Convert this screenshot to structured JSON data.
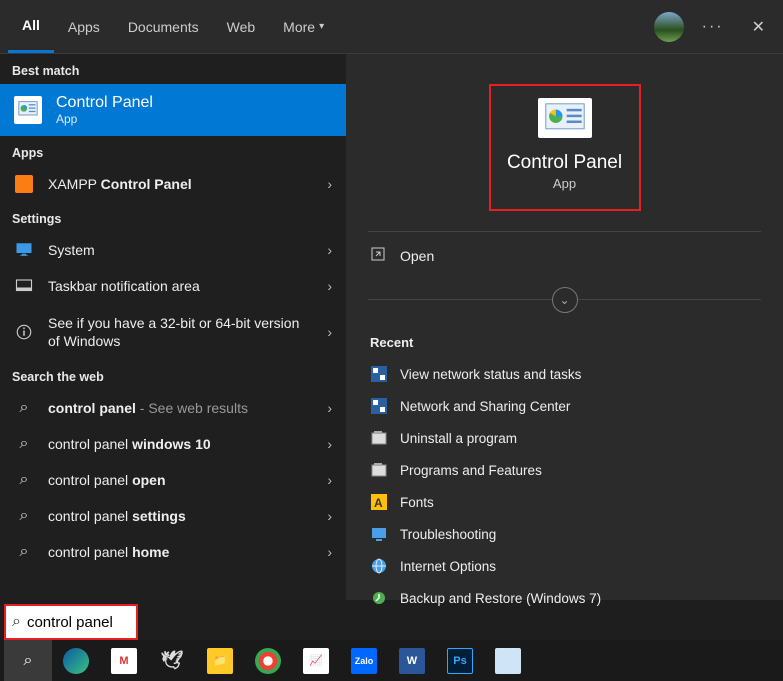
{
  "header": {
    "tabs": [
      "All",
      "Apps",
      "Documents",
      "Web",
      "More"
    ],
    "active_tab": 0
  },
  "left": {
    "best_match_label": "Best match",
    "best_match": {
      "title": "Control Panel",
      "sub": "App"
    },
    "apps_label": "Apps",
    "apps": [
      {
        "prefix": "XAMPP ",
        "bold": "Control Panel"
      }
    ],
    "settings_label": "Settings",
    "settings": [
      {
        "label": "System"
      },
      {
        "label": "Taskbar notification area"
      },
      {
        "label": "See if you have a 32-bit or 64-bit version of Windows"
      }
    ],
    "web_label": "Search the web",
    "web": [
      {
        "bold": "control panel",
        "dim": " - See web results"
      },
      {
        "prefix": "control panel ",
        "bold": "windows 10"
      },
      {
        "prefix": "control panel ",
        "bold": "open"
      },
      {
        "prefix": "control panel ",
        "bold": "settings"
      },
      {
        "prefix": "control panel ",
        "bold": "home"
      }
    ]
  },
  "right": {
    "preview": {
      "title": "Control Panel",
      "sub": "App"
    },
    "open_label": "Open",
    "recent_label": "Recent",
    "recent": [
      "View network status and tasks",
      "Network and Sharing Center",
      "Uninstall a program",
      "Programs and Features",
      "Fonts",
      "Troubleshooting",
      "Internet Options",
      "Backup and Restore (Windows 7)"
    ]
  },
  "search": {
    "value": "control panel"
  }
}
